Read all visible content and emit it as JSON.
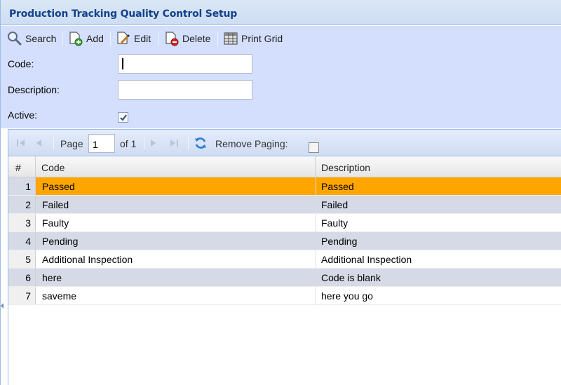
{
  "window": {
    "title": "Production Tracking Quality Control Setup"
  },
  "toolbar": {
    "search_label": "Search",
    "add_label": "Add",
    "edit_label": "Edit",
    "delete_label": "Delete",
    "print_label": "Print Grid"
  },
  "form": {
    "code_label": "Code:",
    "code_value": "",
    "description_label": "Description:",
    "description_value": "",
    "active_label": "Active:",
    "active_checked": true
  },
  "pager": {
    "page_label": "Page",
    "page_value": "1",
    "of_label": "of 1",
    "remove_paging_label": "Remove Paging:",
    "remove_paging_checked": false
  },
  "grid": {
    "columns": [
      "#",
      "Code",
      "Description"
    ],
    "rows": [
      {
        "num": "1",
        "code": "Passed",
        "description": "Passed",
        "selected": true
      },
      {
        "num": "2",
        "code": "Failed",
        "description": "Failed"
      },
      {
        "num": "3",
        "code": "Faulty",
        "description": "Faulty"
      },
      {
        "num": "4",
        "code": "Pending",
        "description": "Pending"
      },
      {
        "num": "5",
        "code": "Additional Inspection",
        "description": "Additional Inspection"
      },
      {
        "num": "6",
        "code": "here",
        "description": "Code is blank"
      },
      {
        "num": "7",
        "code": "saveme",
        "description": "here you go"
      }
    ]
  },
  "colors": {
    "title_text": "#15428b",
    "panel_bg": "#d3dffc",
    "selected_row": "#ffa500",
    "alt_row": "#d5dae6"
  }
}
